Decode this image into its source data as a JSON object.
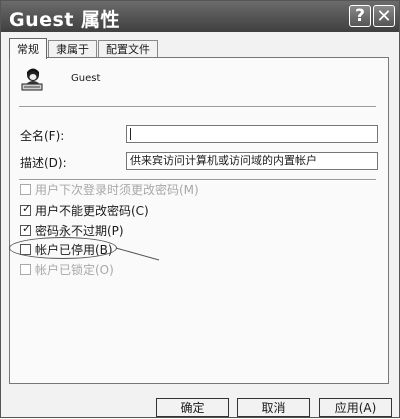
{
  "window": {
    "title": "Guest 属性",
    "help_glyph": "?",
    "close_glyph": "✕"
  },
  "tabs": [
    {
      "label": "常规",
      "active": true
    },
    {
      "label": "隶属于",
      "active": false
    },
    {
      "label": "配置文件",
      "active": false
    }
  ],
  "user": {
    "name": "Guest"
  },
  "fields": {
    "fullname": {
      "label": "全名(F):",
      "value": ""
    },
    "description": {
      "label": "描述(D):",
      "value": "供来宾访问计算机或访问域的内置帐户"
    }
  },
  "checkboxes": [
    {
      "label": "用户下次登录时须更改密码(M)",
      "checked": false,
      "disabled": true
    },
    {
      "label": "用户不能更改密码(C)",
      "checked": true,
      "disabled": false
    },
    {
      "label": "密码永不过期(P)",
      "checked": true,
      "disabled": false
    },
    {
      "label": "帐户已停用(B)",
      "checked": false,
      "disabled": false
    },
    {
      "label": "帐户已锁定(O)",
      "checked": false,
      "disabled": true
    }
  ],
  "buttons": {
    "ok": "确定",
    "cancel": "取消",
    "apply": "应用(A)"
  }
}
